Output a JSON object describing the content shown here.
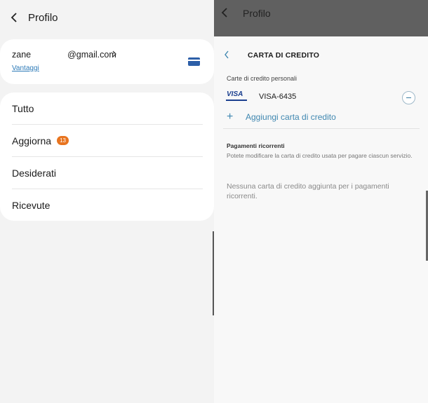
{
  "left": {
    "header": {
      "title": "Profilo"
    },
    "account": {
      "email_prefix": "zane",
      "email_suffix": "@gmail.com",
      "chevron": ">",
      "benefits_link": "Vantaggi",
      "card_icon": "credit-card-icon"
    },
    "menu": [
      {
        "label": "Tutto"
      },
      {
        "label": "Aggiorna",
        "badge": "13"
      },
      {
        "label": "Desiderati"
      },
      {
        "label": "Ricevute"
      }
    ],
    "badge_color": "#e8741f"
  },
  "right": {
    "header": {
      "title": "Profilo"
    },
    "sheet": {
      "title": "CARTA DI CREDITO",
      "personal_section": "Carte di credito personali",
      "card": {
        "logo": "VISA",
        "name": "VISA-6435"
      },
      "add_label": "Aggiungi carta di credito",
      "recurring_title": "Pagamenti ricorrenti",
      "recurring_desc": "Potete modificare la carta di credito usata per pagare ciascun servizio.",
      "recurring_empty": "Nessuna carta di credito aggiunta per i pagamenti ricorrenti."
    },
    "accent": "#3f87b0"
  }
}
